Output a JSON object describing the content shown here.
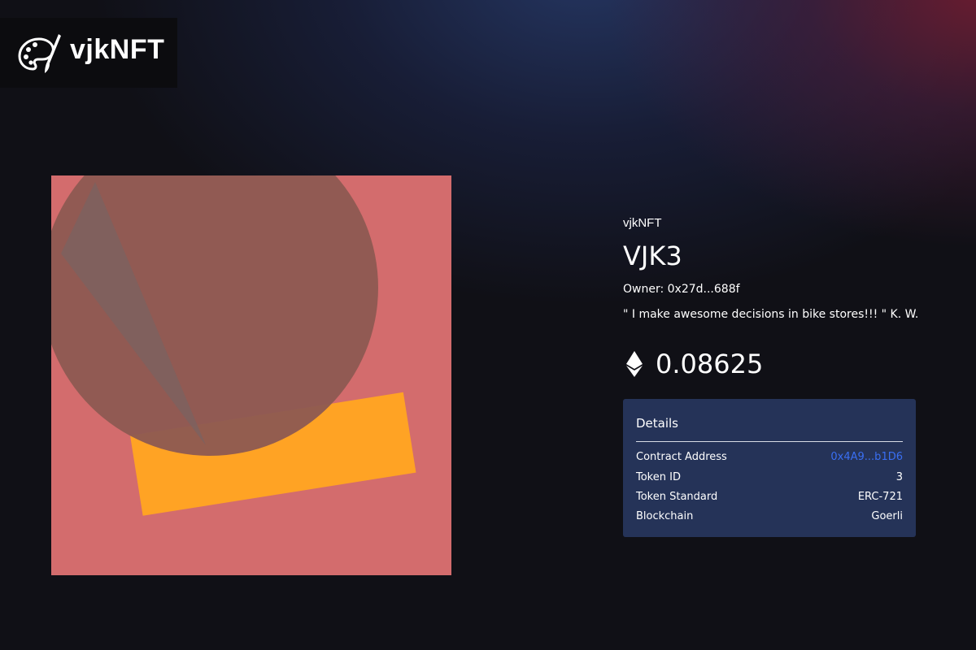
{
  "brand": {
    "name": "vjkNFT",
    "icon": "palette-brush-icon"
  },
  "artwork": {
    "colors": {
      "background": "#d36c6d",
      "circle": "#8d5a52",
      "triangle": "#7d625f",
      "rectangle": "#ffa324"
    }
  },
  "token": {
    "collection": "vjkNFT",
    "name": "VJK3",
    "owner": "Owner: 0x27d...688f",
    "description": "\" I make awesome decisions in bike stores!!! \" K. W.",
    "price_icon": "ethereum-icon",
    "price": "0.08625"
  },
  "details": {
    "title": "Details",
    "rows": [
      {
        "label": "Contract Address",
        "value": "0x4A9...b1D6"
      },
      {
        "label": "Token ID",
        "value": "3"
      },
      {
        "label": "Token Standard",
        "value": "ERC-721"
      },
      {
        "label": "Blockchain",
        "value": "Goerli"
      }
    ],
    "link_color": "#3a6ff2",
    "panel_color": "#253358"
  }
}
